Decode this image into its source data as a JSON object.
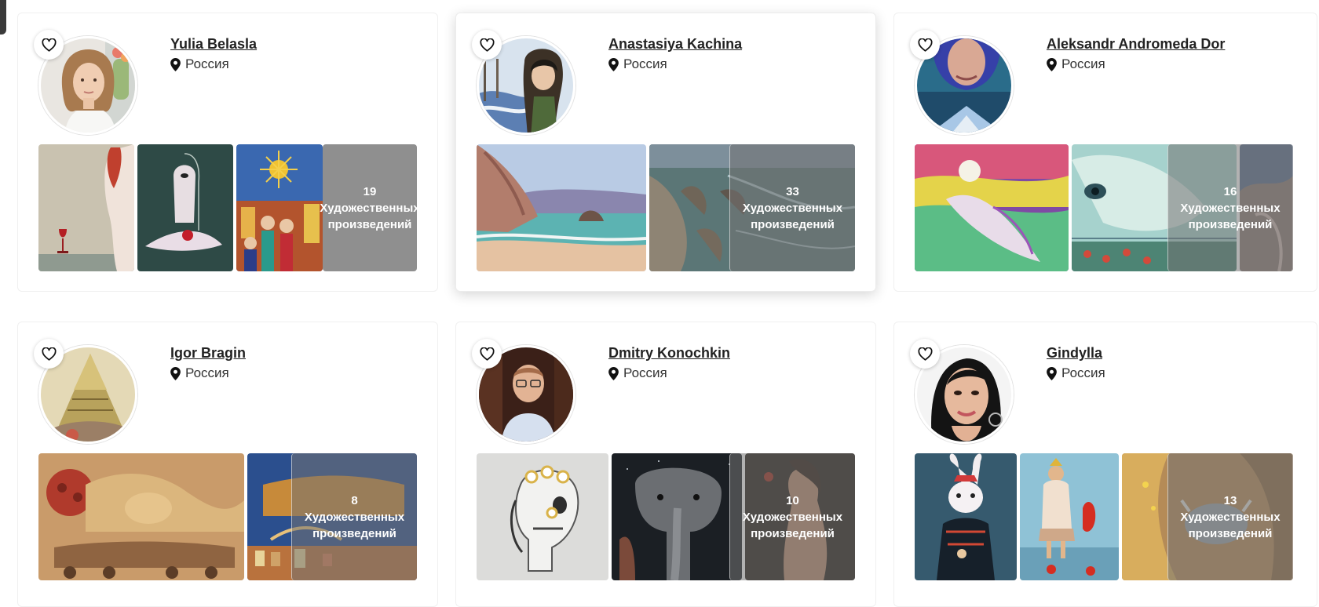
{
  "gallery_more_caption_line1": "Художественных",
  "gallery_more_caption_line2": "произведений",
  "artists": [
    {
      "name": "Yulia Belasla",
      "country": "Россия",
      "artworks_count": "19"
    },
    {
      "name": "Anastasiya Kachina",
      "country": "Россия",
      "artworks_count": "33"
    },
    {
      "name": "Aleksandr Andromeda Dor",
      "country": "Россия",
      "artworks_count": "16"
    },
    {
      "name": "Igor Bragin",
      "country": "Россия",
      "artworks_count": "8"
    },
    {
      "name": "Dmitry Konochkin",
      "country": "Россия",
      "artworks_count": "10"
    },
    {
      "name": "Gindylla",
      "country": "Россия",
      "artworks_count": "13"
    }
  ],
  "icons": {
    "favorite": "heart-outline-icon",
    "location": "map-pin-icon"
  },
  "colors": {
    "overlay": "#8f8f8f",
    "text": "#222222",
    "card_border": "#f0f0f0"
  }
}
